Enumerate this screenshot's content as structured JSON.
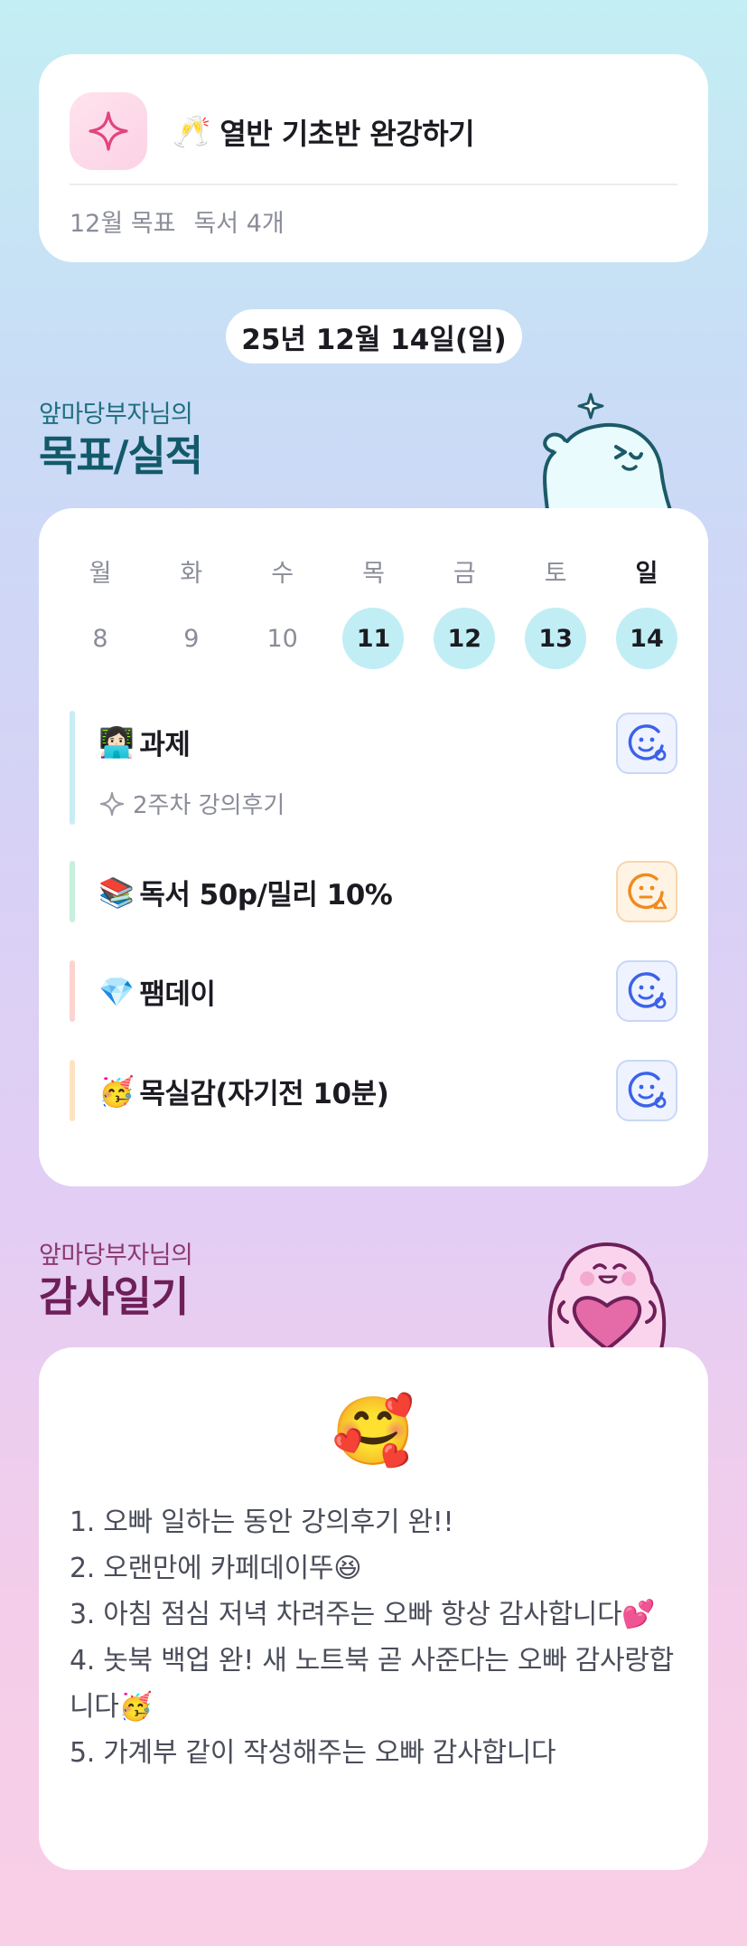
{
  "goal": {
    "emoji": "🥂",
    "title": "열반 기초반 완강하기",
    "month_label": "12월 목표",
    "month_goal": "독서 4개",
    "icon": "sparkle-icon"
  },
  "date": "25년 12월 14일(일)",
  "goals_section": {
    "owner": "앞마당부자님의",
    "title": "목표/실적"
  },
  "calendar": {
    "weekdays": [
      "월",
      "화",
      "수",
      "목",
      "금",
      "토",
      "일"
    ],
    "days": [
      "8",
      "9",
      "10",
      "11",
      "12",
      "13",
      "14"
    ],
    "active_days": [
      "11",
      "12",
      "13",
      "14"
    ]
  },
  "tasks": [
    {
      "emoji": "👩🏻‍💻",
      "title": "과제",
      "sub": "2주차 강의후기",
      "bar_color": "#c8eef4",
      "status_icon": "smile-face-icon",
      "status_color": "#3b62e8"
    },
    {
      "emoji": "📚",
      "title": "독서 50p/밀리 10%",
      "sub": "",
      "bar_color": "#c6f0dd",
      "status_icon": "neutral-face-warning-icon",
      "status_color": "#f08a1c"
    },
    {
      "emoji": "💎",
      "title": "팸데이",
      "sub": "",
      "bar_color": "#fbd3cf",
      "status_icon": "smile-face-icon",
      "status_color": "#3b62e8"
    },
    {
      "emoji": "🥳",
      "title": "목실감(자기전 10분)",
      "sub": "",
      "bar_color": "#fde3c2",
      "status_icon": "smile-face-icon",
      "status_color": "#3b62e8"
    }
  ],
  "thanks_section": {
    "owner": "앞마당부자님의",
    "title": "감사일기",
    "emoji": "🥰",
    "lines": [
      "1. 오빠 일하는 동안 강의후기 완!!",
      "2. 오랜만에 카페데이뚜😆",
      "3. 아침 점심 저녁 차려주는 오빠 항상 감사합니다💕",
      "4. 놋북 백업 완! 새 노트북 곧 사준다는 오빠 감사랑합니다🥳",
      "5. 가계부 같이 작성해주는 오빠 감사합니다"
    ]
  }
}
